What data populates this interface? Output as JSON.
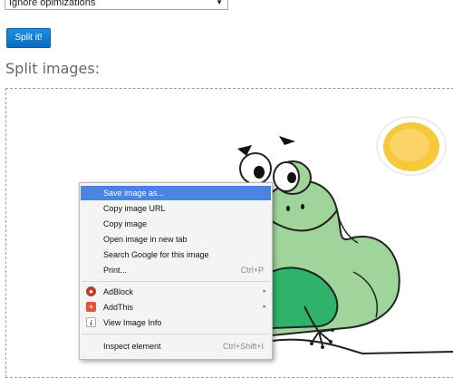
{
  "optimization_select": {
    "value": "Ignore opimizations",
    "arrow": "▼"
  },
  "split_button": {
    "label": "Split it!"
  },
  "section_title": "Split images:",
  "context_menu": {
    "items": [
      {
        "label": "Save image as...",
        "shortcut": ""
      },
      {
        "label": "Copy image URL",
        "shortcut": ""
      },
      {
        "label": "Copy image",
        "shortcut": ""
      },
      {
        "label": "Open image in new tab",
        "shortcut": ""
      },
      {
        "label": "Search Google for this image",
        "shortcut": ""
      },
      {
        "label": "Print...",
        "shortcut": "Ctrl+P"
      },
      {
        "label": "AdBlock",
        "icon": "adblock-icon",
        "submenu": "▸"
      },
      {
        "label": "AddThis",
        "icon": "addthis-icon",
        "submenu": "▸"
      },
      {
        "label": "View Image Info",
        "icon": "info-icon",
        "icon_glyph": "i"
      },
      {
        "label": "Inspect element",
        "shortcut": "Ctrl+Shift+I"
      }
    ]
  },
  "colors": {
    "button_blue": "#0a6cc4",
    "menu_highlight": "#4a83e0",
    "frog_green": "#9fd49a",
    "frog_belly": "#2fb36b",
    "sun_yellow": "#f7c83c"
  }
}
